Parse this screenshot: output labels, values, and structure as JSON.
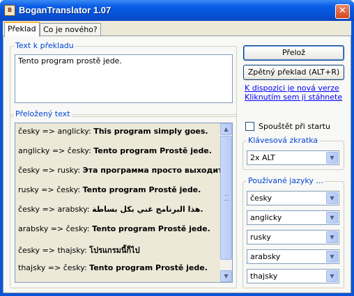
{
  "window": {
    "title": "BoganTranslator 1.07",
    "close_glyph": "✕",
    "icon": "bogan-app-icon"
  },
  "tabs": [
    {
      "label": "Překlad",
      "active": true
    },
    {
      "label": "Co je nového?",
      "active": false
    }
  ],
  "source": {
    "group_title": "Text k překladu",
    "text": "Tento program prostě jede."
  },
  "actions": {
    "translate_label": "Přelož",
    "back_translate_label": "Zpětný překlad (ALT+R)",
    "update_link_line1": "K dispozici je nová verze",
    "update_link_line2": "Kliknutím sem ji stáhnete"
  },
  "results": {
    "group_title": "Přeložený text",
    "rows": [
      {
        "direction": "česky => anglicky:",
        "text": "This program simply goes."
      },
      {
        "direction": "anglicky => česky:",
        "text": "Tento program Prostě jede."
      },
      {
        "direction": "česky => rusky:",
        "text": "Эта программа просто выходит."
      },
      {
        "direction": "rusky => česky:",
        "text": "Tento program Prostě jede."
      },
      {
        "direction": "česky => arabsky:",
        "text": "هذا البرنامج غني بكل بساطة."
      },
      {
        "direction": "arabsky => česky:",
        "text": "Tento program Prostě jede."
      },
      {
        "direction": "česky => thajsky:",
        "text": "โปรแกรมนี้ก็ไป"
      },
      {
        "direction": "thajsky => česky:",
        "text": "Tento program Prostě jede."
      }
    ]
  },
  "settings": {
    "startup_label": "Spouštět při startu",
    "startup_checked": false,
    "hotkey_group_title": "Klávesová zkratka",
    "hotkey_value": "2x ALT",
    "languages_group_title": "Používané jazyky ...",
    "languages": [
      "česky",
      "anglicky",
      "rusky",
      "arabsky",
      "thajsky"
    ]
  },
  "colors": {
    "titlebar": "#0a5ee6",
    "group_title": "#0046d5",
    "link": "#0000ff",
    "face": "#ece9d8"
  }
}
